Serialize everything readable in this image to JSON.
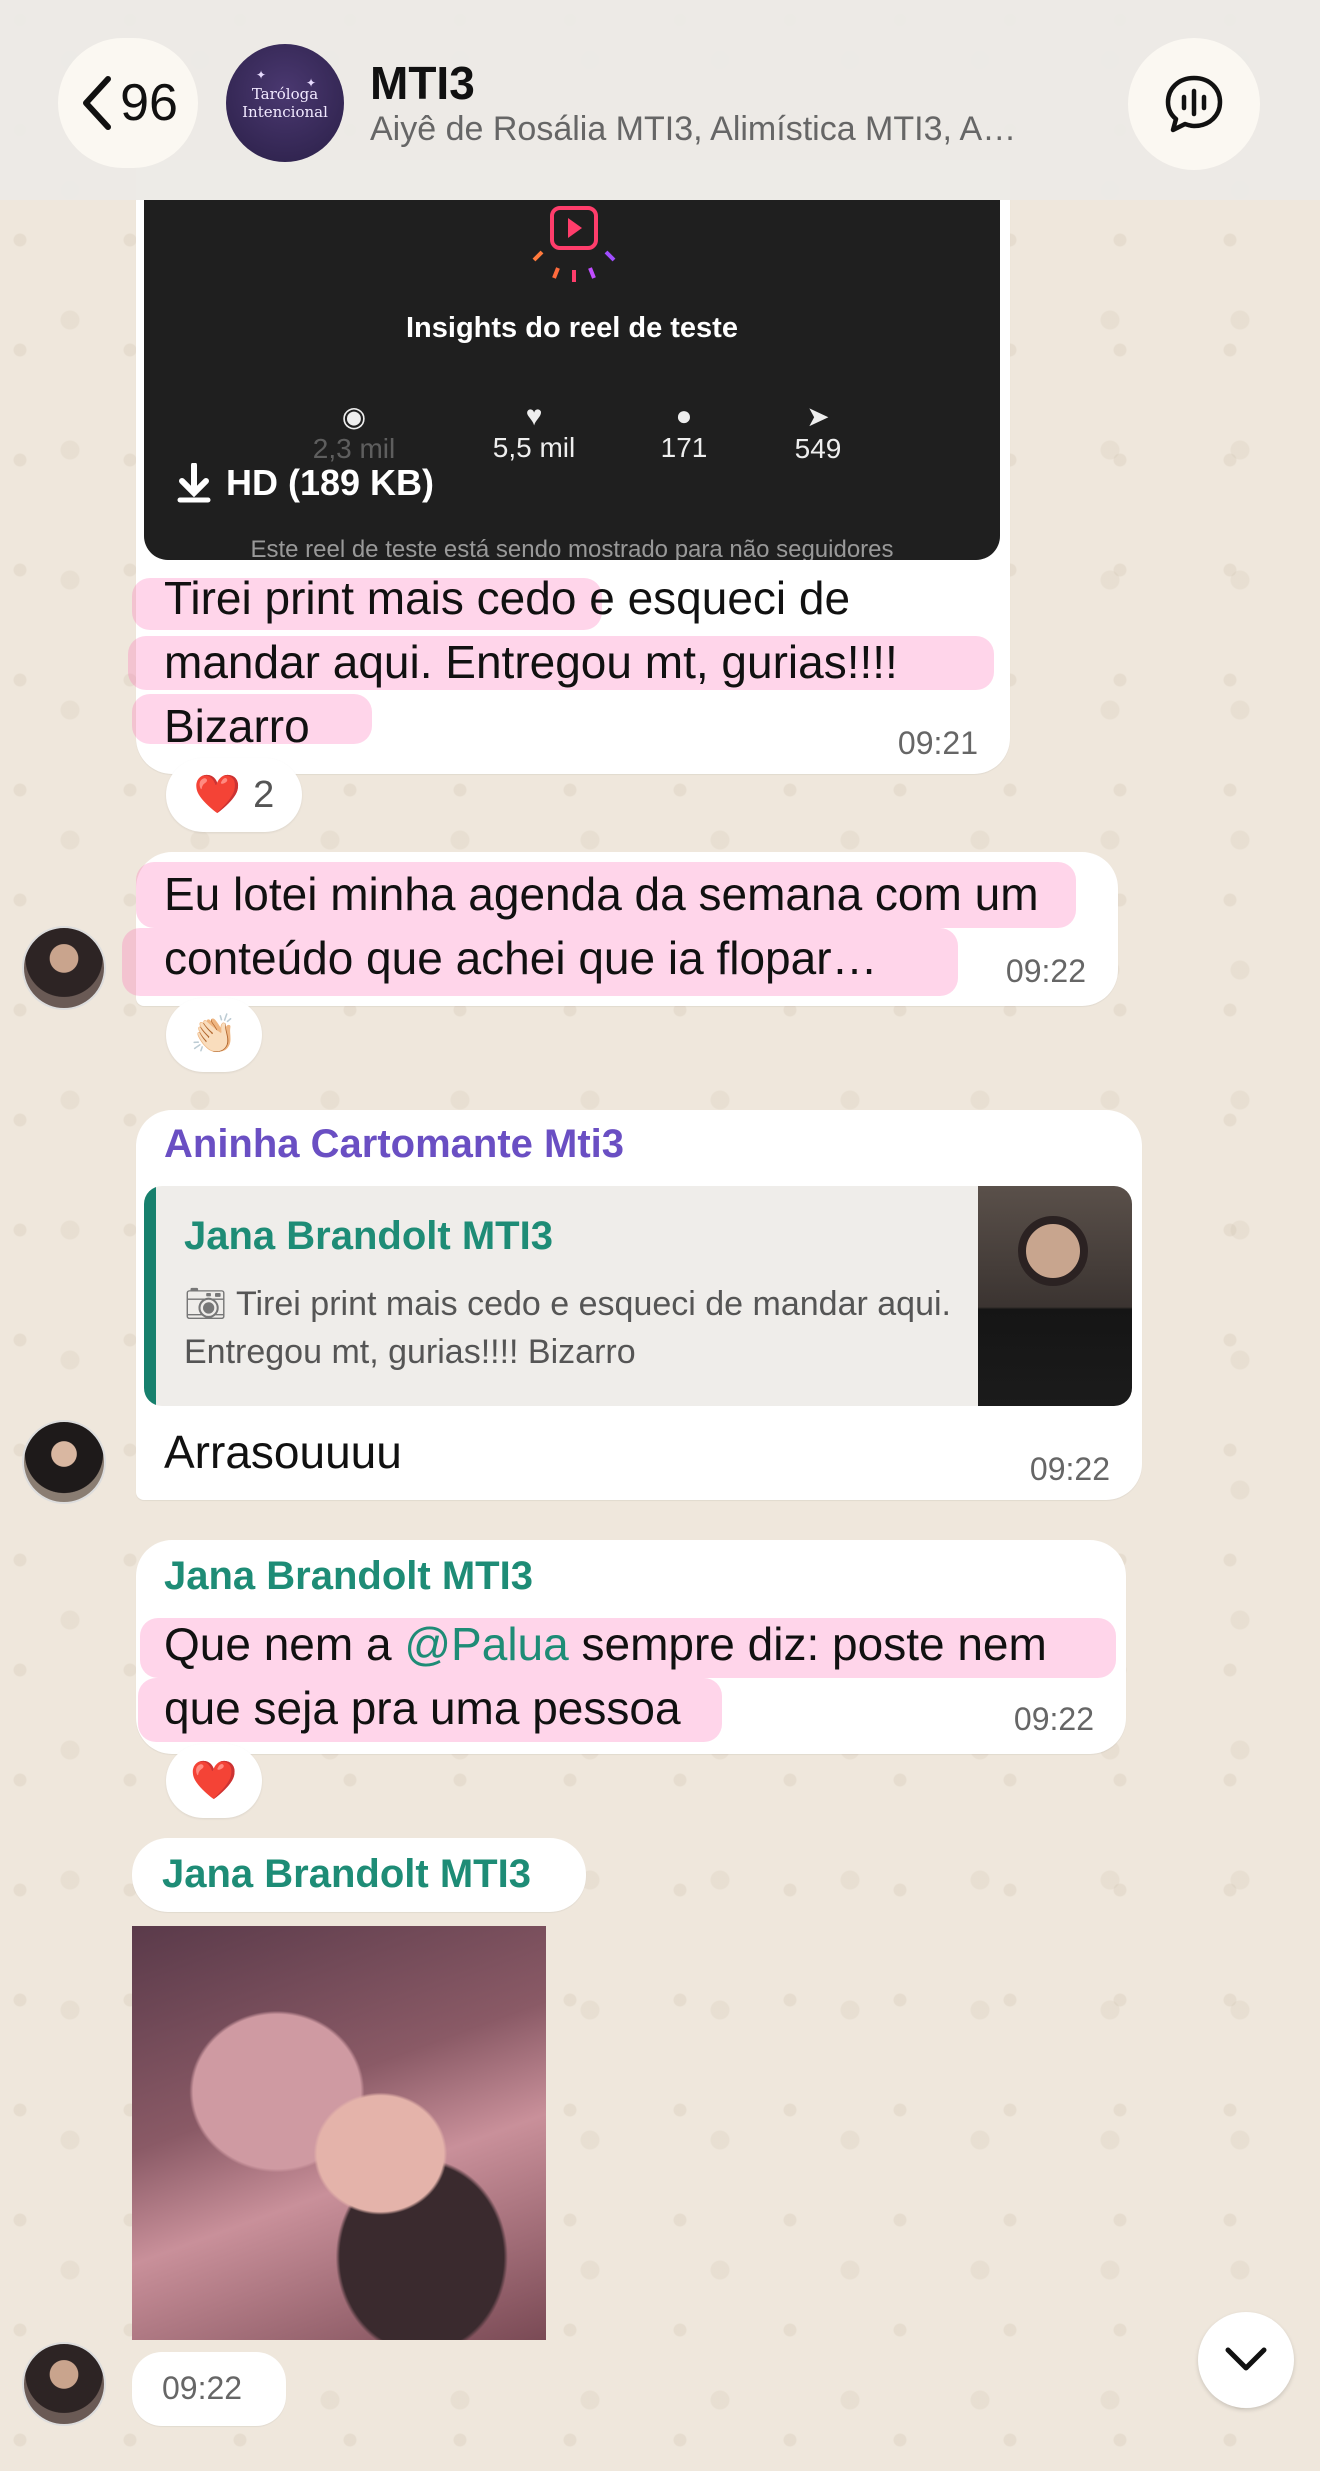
{
  "header": {
    "back_count": "96",
    "group_title": "MTI3",
    "group_members": "Aiyê de Rosália MTI3, Alimística MTI3, A…",
    "avatar_text_line1": "Taróloga",
    "avatar_text_line2": "Intencional"
  },
  "media1": {
    "insights_title": "Insights do reel de teste",
    "stat_views": "2,3 mil",
    "stat_likes": "5,5 mil",
    "stat_comments": "171",
    "stat_shares": "549",
    "download_label": "HD (189 KB)",
    "footer_text": "Este reel de teste está sendo mostrado para não seguidores"
  },
  "messages": {
    "m1": {
      "text": "Tirei print mais cedo e esqueci de mandar aqui. Entregou mt, gurias!!!! Bizarro",
      "time": "09:21",
      "reaction_emoji": "❤️",
      "reaction_count": "2"
    },
    "m2": {
      "text": "Eu lotei minha agenda da semana com um conteúdo que achei que ia flopar…",
      "time": "09:22",
      "reaction_emoji": "👏🏻"
    },
    "m3": {
      "sender": "Aninha Cartomante Mti3",
      "quote_sender": "Jana Brandolt MTI3",
      "quote_text": "Tirei print mais cedo e esqueci de mandar aqui. Entregou mt, gurias!!!! Bizarro",
      "text": "Arrasouuuu",
      "time": "09:22"
    },
    "m4": {
      "sender": "Jana Brandolt MTI3",
      "text_before": "Que nem a ",
      "mention": "@Palua",
      "text_after": " sempre diz: poste nem que seja pra uma pessoa",
      "time": "09:22",
      "reaction_emoji": "❤️"
    },
    "m5": {
      "sender": "Jana Brandolt MTI3",
      "time": "09:22"
    }
  },
  "colors": {
    "sender_purple": "#6a4fc3",
    "sender_teal": "#1e8c76",
    "highlight_pink": "#ff69b4",
    "quote_bar": "#17806d"
  }
}
